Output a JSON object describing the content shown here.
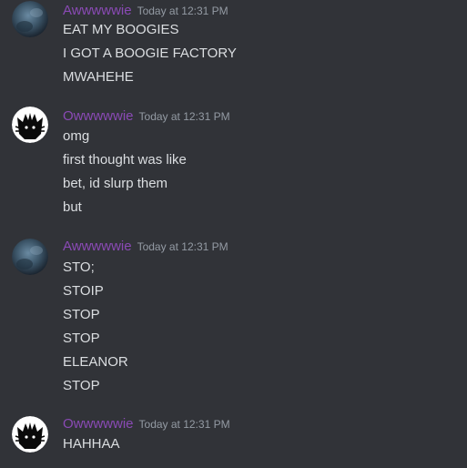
{
  "accent_username_color": "#8a4ab5",
  "messages": [
    {
      "author": "Awwwwwie",
      "avatar_icon": "dark-blue-round-avatar-icon",
      "timestamp": "Today at 12:31 PM",
      "lines": [
        "EAT MY BOOGIES",
        "I GOT A BOOGIE FACTORY",
        "MWAHEHE"
      ]
    },
    {
      "author": "Owwwwwie",
      "avatar_icon": "black-cat-silhouette-avatar-icon",
      "timestamp": "Today at 12:31 PM",
      "lines": [
        "omg",
        "first thought was like",
        "bet, id slurp them",
        "but"
      ]
    },
    {
      "author": "Awwwwwie",
      "avatar_icon": "dark-blue-round-avatar-icon",
      "timestamp": "Today at 12:31 PM",
      "lines": [
        "STO;",
        "STOIP",
        "STOP",
        "STOP",
        "ELEANOR",
        "STOP"
      ]
    },
    {
      "author": "Owwwwwie",
      "avatar_icon": "black-cat-silhouette-avatar-icon",
      "timestamp": "Today at 12:31 PM",
      "lines": [
        "HAHHAA"
      ]
    }
  ]
}
